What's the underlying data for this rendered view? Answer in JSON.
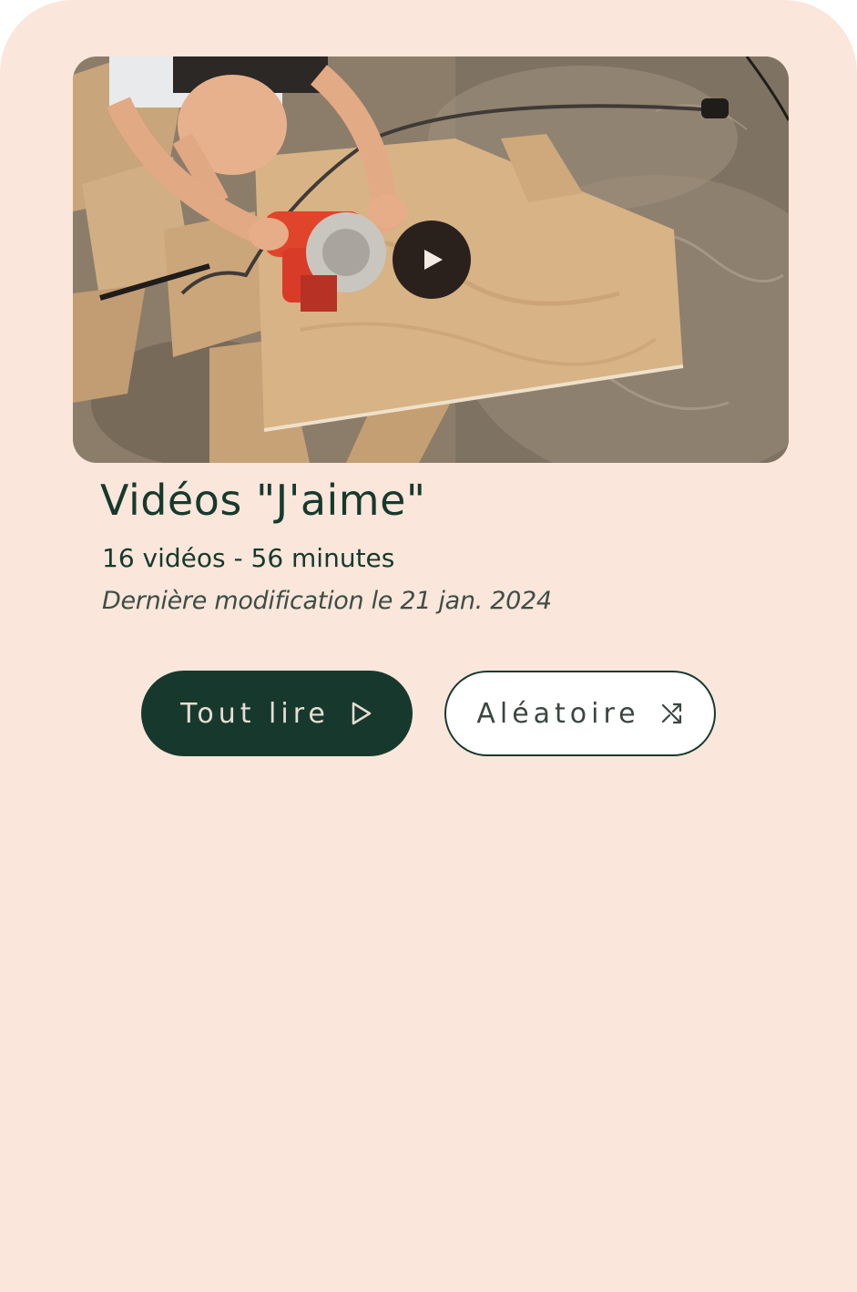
{
  "playlist": {
    "title": "Vidéos \"J'aime\"",
    "meta": "16 vidéos - 56 minutes",
    "modified": "Dernière modification le 21 jan. 2024"
  },
  "thumbnail": {
    "icon": "play-icon"
  },
  "actions": {
    "play_all_label": "Tout lire",
    "play_all_icon": "play-outline-icon",
    "shuffle_label": "Aléatoire",
    "shuffle_icon": "shuffle-icon"
  },
  "colors": {
    "background": "#fae6da",
    "primary": "#17392d",
    "play_overlay": "#2a211d"
  }
}
